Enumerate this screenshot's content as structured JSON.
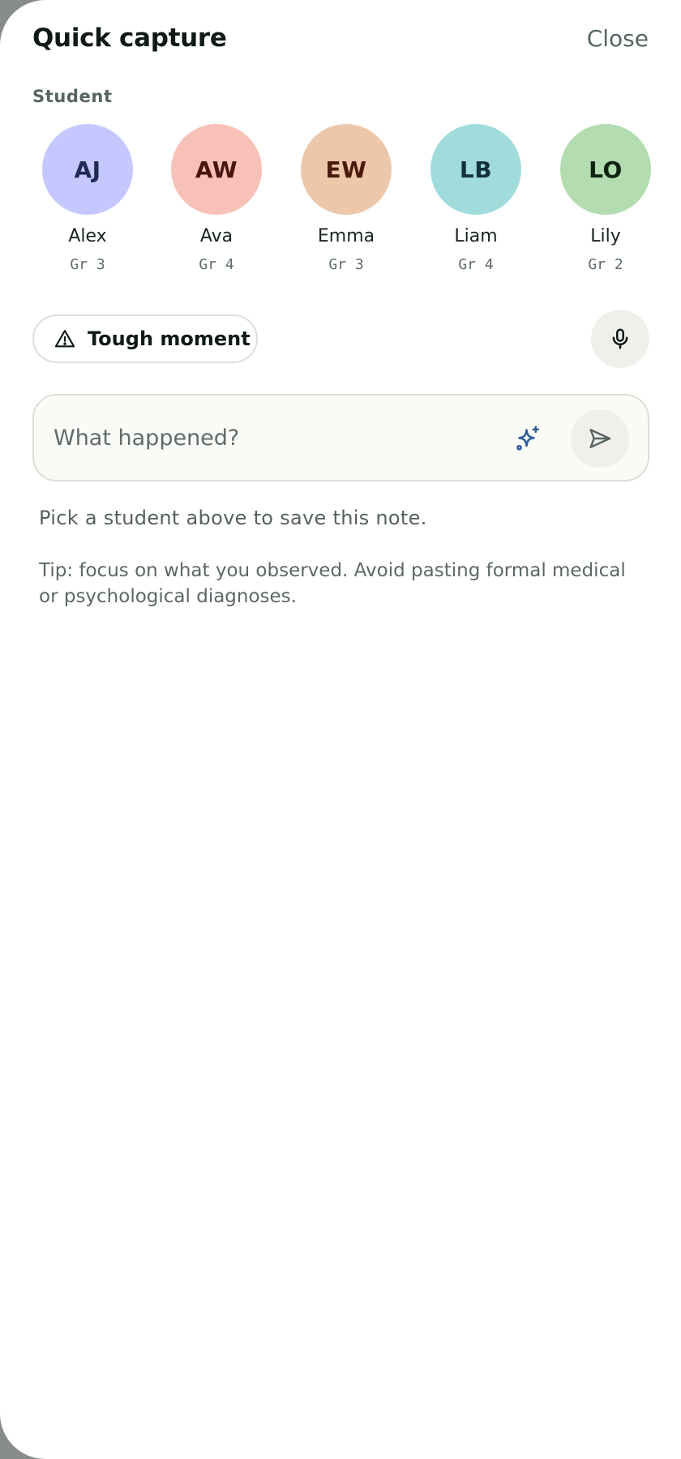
{
  "header": {
    "title": "Quick capture",
    "close_label": "Close"
  },
  "students_section": {
    "label": "Student",
    "items": [
      {
        "initials": "AJ",
        "name": "Alex",
        "grade": "Gr 3",
        "bg": "#c4c8fe",
        "fg": "#1f2a52"
      },
      {
        "initials": "AW",
        "name": "Ava",
        "grade": "Gr 4",
        "bg": "#f8c1b7",
        "fg": "#4a1410"
      },
      {
        "initials": "EW",
        "name": "Emma",
        "grade": "Gr 3",
        "bg": "#ecc7a9",
        "fg": "#4a1a0c"
      },
      {
        "initials": "LB",
        "name": "Liam",
        "grade": "Gr 4",
        "bg": "#a1dcdc",
        "fg": "#15323a"
      },
      {
        "initials": "LO",
        "name": "Lily",
        "grade": "Gr 2",
        "bg": "#b3dcb1",
        "fg": "#0f2212"
      }
    ]
  },
  "tag_chip": {
    "label": "Tough moment",
    "icon": "warning-triangle-icon"
  },
  "mic": {
    "icon": "microphone-icon"
  },
  "note_input": {
    "value": "",
    "placeholder": "What happened?",
    "assist_icon": "sparkle-icon",
    "send_icon": "send-icon"
  },
  "hint": "Pick a student above to save this note.",
  "tip": "Tip: focus on what you observed. Avoid pasting formal medical or psychological diagnoses.",
  "colors": {
    "accent": "#2f5d9a",
    "muted_text": "#566463",
    "backdrop": "#878b8a"
  }
}
